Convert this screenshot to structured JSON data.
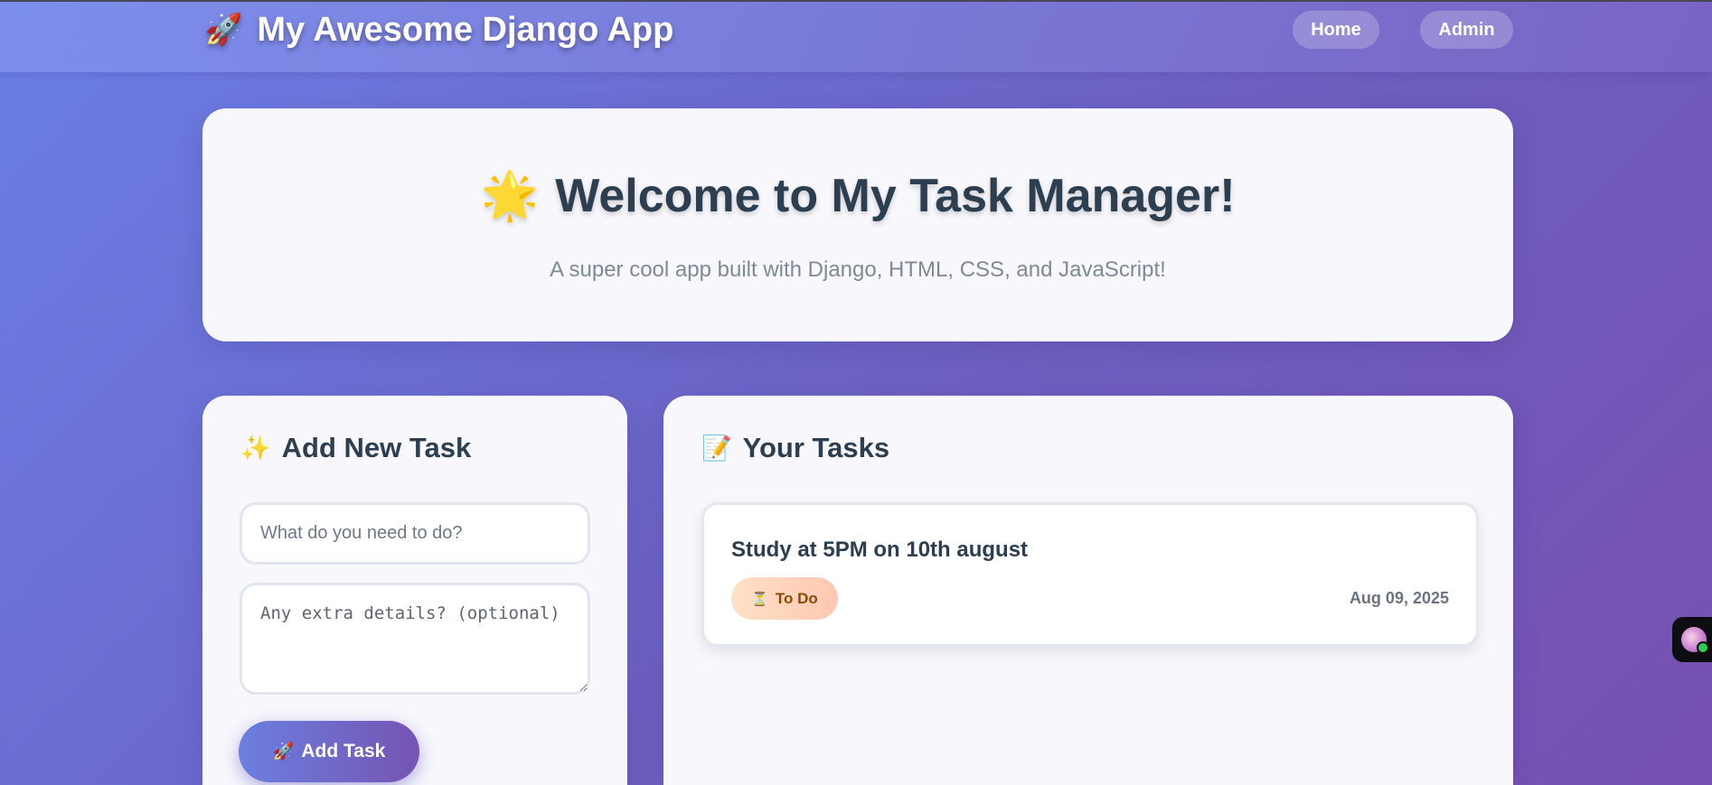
{
  "header": {
    "brand_icon": "🚀",
    "brand_title": "My Awesome Django App",
    "nav": {
      "home": "Home",
      "admin": "Admin"
    }
  },
  "hero": {
    "icon": "🌟",
    "title": "Welcome to My Task Manager!",
    "subtitle": "A super cool app built with Django, HTML, CSS, and JavaScript!"
  },
  "add_task": {
    "icon": "✨",
    "heading": "Add New Task",
    "title_placeholder": "What do you need to do?",
    "details_placeholder": "Any extra details? (optional)",
    "button_icon": "🚀",
    "button_label": "Add Task"
  },
  "tasks": {
    "icon": "📝",
    "heading": "Your Tasks",
    "items": [
      {
        "title": "Study at 5PM on 10th august",
        "status_icon": "⏳",
        "status": "To Do",
        "date": "Aug 09, 2025"
      }
    ]
  },
  "colors": {
    "accent_start": "#6b7fe0",
    "accent_end": "#7654b2",
    "heading_text": "#2c3e50",
    "status_badge_text": "#8a4a06"
  }
}
